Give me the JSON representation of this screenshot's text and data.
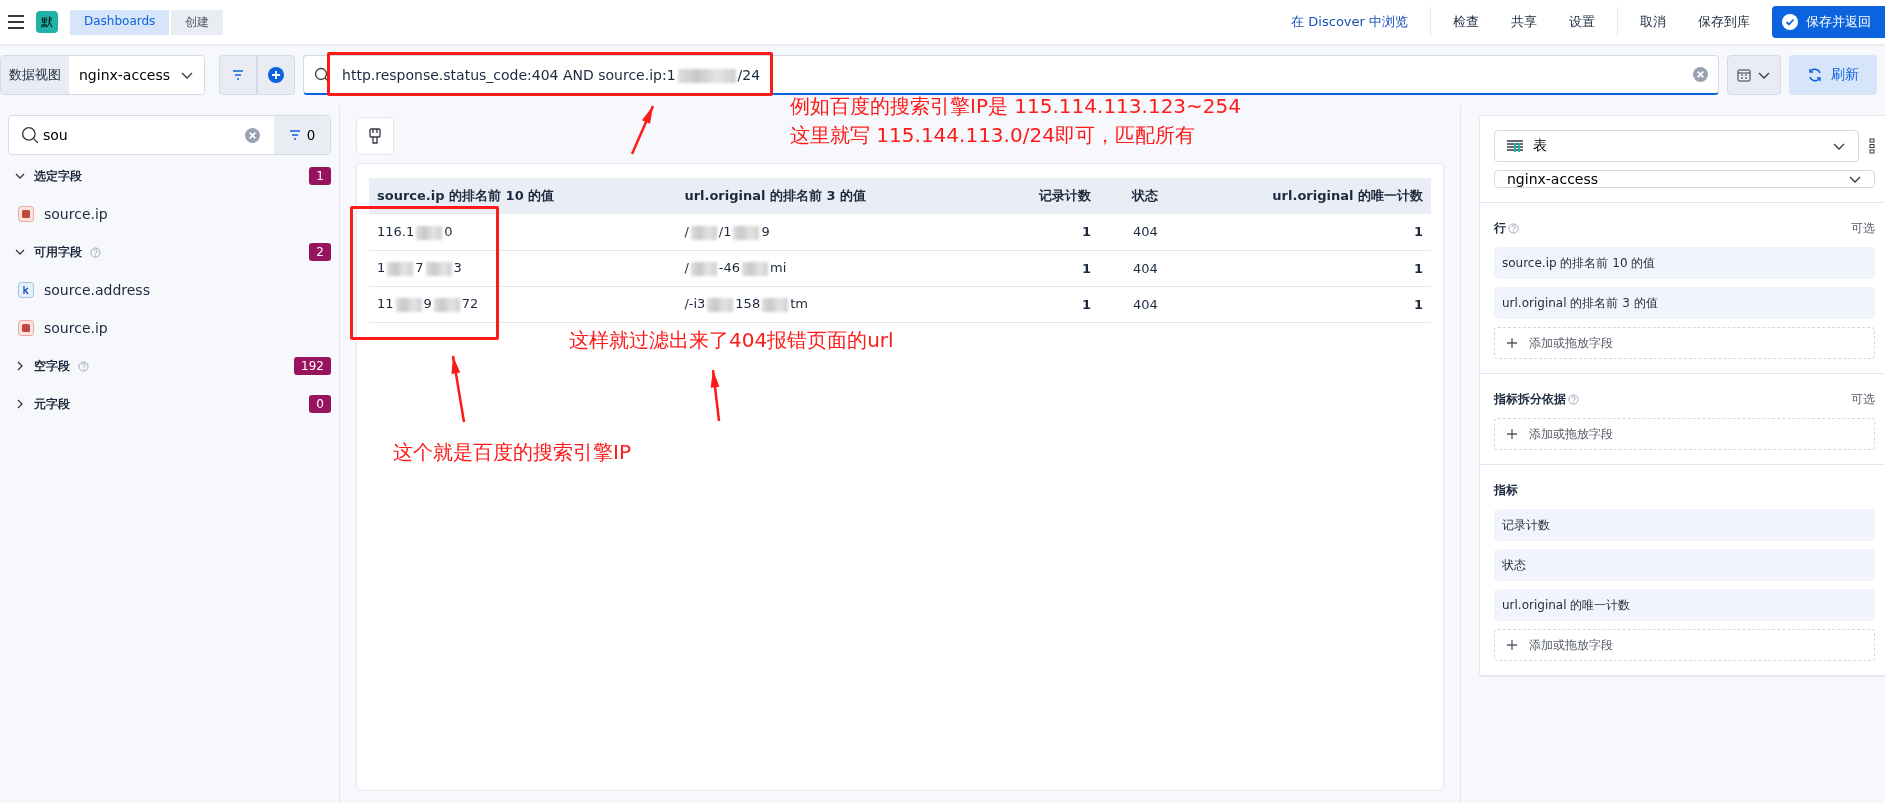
{
  "header": {
    "app_badge": "默",
    "breadcrumbs": [
      {
        "label": "Dashboards",
        "selected": false
      },
      {
        "label": "创建",
        "selected": true
      }
    ],
    "links": [
      "在 Discover 中浏览",
      "检查",
      "共享",
      "设置",
      "取消",
      "保存到库"
    ],
    "primary_button": "保存并返回"
  },
  "query_bar": {
    "data_view_label": "数据视图",
    "data_view": "nginx-access",
    "query_prefix": "http.response.status_code:404 AND source.ip:1",
    "query_suffix": "/24",
    "refresh": "刷新"
  },
  "field_list": {
    "search": "sou",
    "filter_count": "0",
    "groups": [
      {
        "label": "选定字段",
        "count": "1",
        "expanded": true,
        "help": false,
        "fields": [
          {
            "name": "source.ip",
            "kind": "ip"
          }
        ]
      },
      {
        "label": "可用字段",
        "count": "2",
        "expanded": true,
        "help": true,
        "fields": [
          {
            "name": "source.address",
            "kind": "keyword"
          },
          {
            "name": "source.ip",
            "kind": "ip"
          }
        ]
      },
      {
        "label": "空字段",
        "count": "192",
        "expanded": false,
        "help": true
      },
      {
        "label": "元字段",
        "count": "0",
        "expanded": false,
        "help": false
      }
    ]
  },
  "table": {
    "columns": [
      "source.ip 的排名前 10 的值",
      "url.original 的排名前 3 的值",
      "记录计数",
      "状态",
      "url.original 的唯一计数"
    ],
    "rows": [
      [
        {
          "parts": [
            "116.1",
            "0"
          ]
        },
        {
          "parts": [
            "/",
            "/1",
            "9"
          ]
        },
        {
          "parts": [
            "1"
          ],
          "bold": true
        },
        {
          "parts": [
            "404"
          ],
          "bold": false
        },
        {
          "parts": [
            "1"
          ],
          "bold": true
        }
      ],
      [
        {
          "parts": [
            "1",
            "7",
            "3"
          ]
        },
        {
          "parts": [
            "/",
            "-46",
            "mi"
          ]
        },
        {
          "parts": [
            "1"
          ],
          "bold": true
        },
        {
          "parts": [
            "404"
          ],
          "bold": false
        },
        {
          "parts": [
            "1"
          ],
          "bold": true
        }
      ],
      [
        {
          "parts": [
            "11",
            "9",
            "72"
          ]
        },
        {
          "parts": [
            "/-i3",
            "158",
            "tm"
          ]
        },
        {
          "parts": [
            "1"
          ],
          "bold": true
        },
        {
          "parts": [
            "404"
          ],
          "bold": false
        },
        {
          "parts": [
            "1"
          ],
          "bold": true
        }
      ]
    ]
  },
  "config_panel": {
    "chart_type": "表",
    "data_view": "nginx-access",
    "sections": [
      {
        "title": "行",
        "help": true,
        "optional": "可选",
        "items": [
          "source.ip 的排名前 10 的值",
          "url.original 的排名前 3 的值"
        ],
        "add": "添加或拖放字段"
      },
      {
        "title": "指标拆分依据",
        "help": true,
        "optional": "可选",
        "add": "添加或拖放字段"
      },
      {
        "title": "指标",
        "help": false,
        "items": [
          "记录计数",
          "状态",
          "url.original 的唯一计数"
        ],
        "add": "添加或拖放字段"
      }
    ]
  },
  "annotations": {
    "query_note": [
      "例如百度的搜索引擎IP是 115.114.113.123~254",
      "这里就写 115.144.113.0/24即可，匹配所有"
    ],
    "result_note": "这样就过滤出来了404报错页面的url",
    "ip_note": "这个就是百度的搜索引擎IP"
  }
}
